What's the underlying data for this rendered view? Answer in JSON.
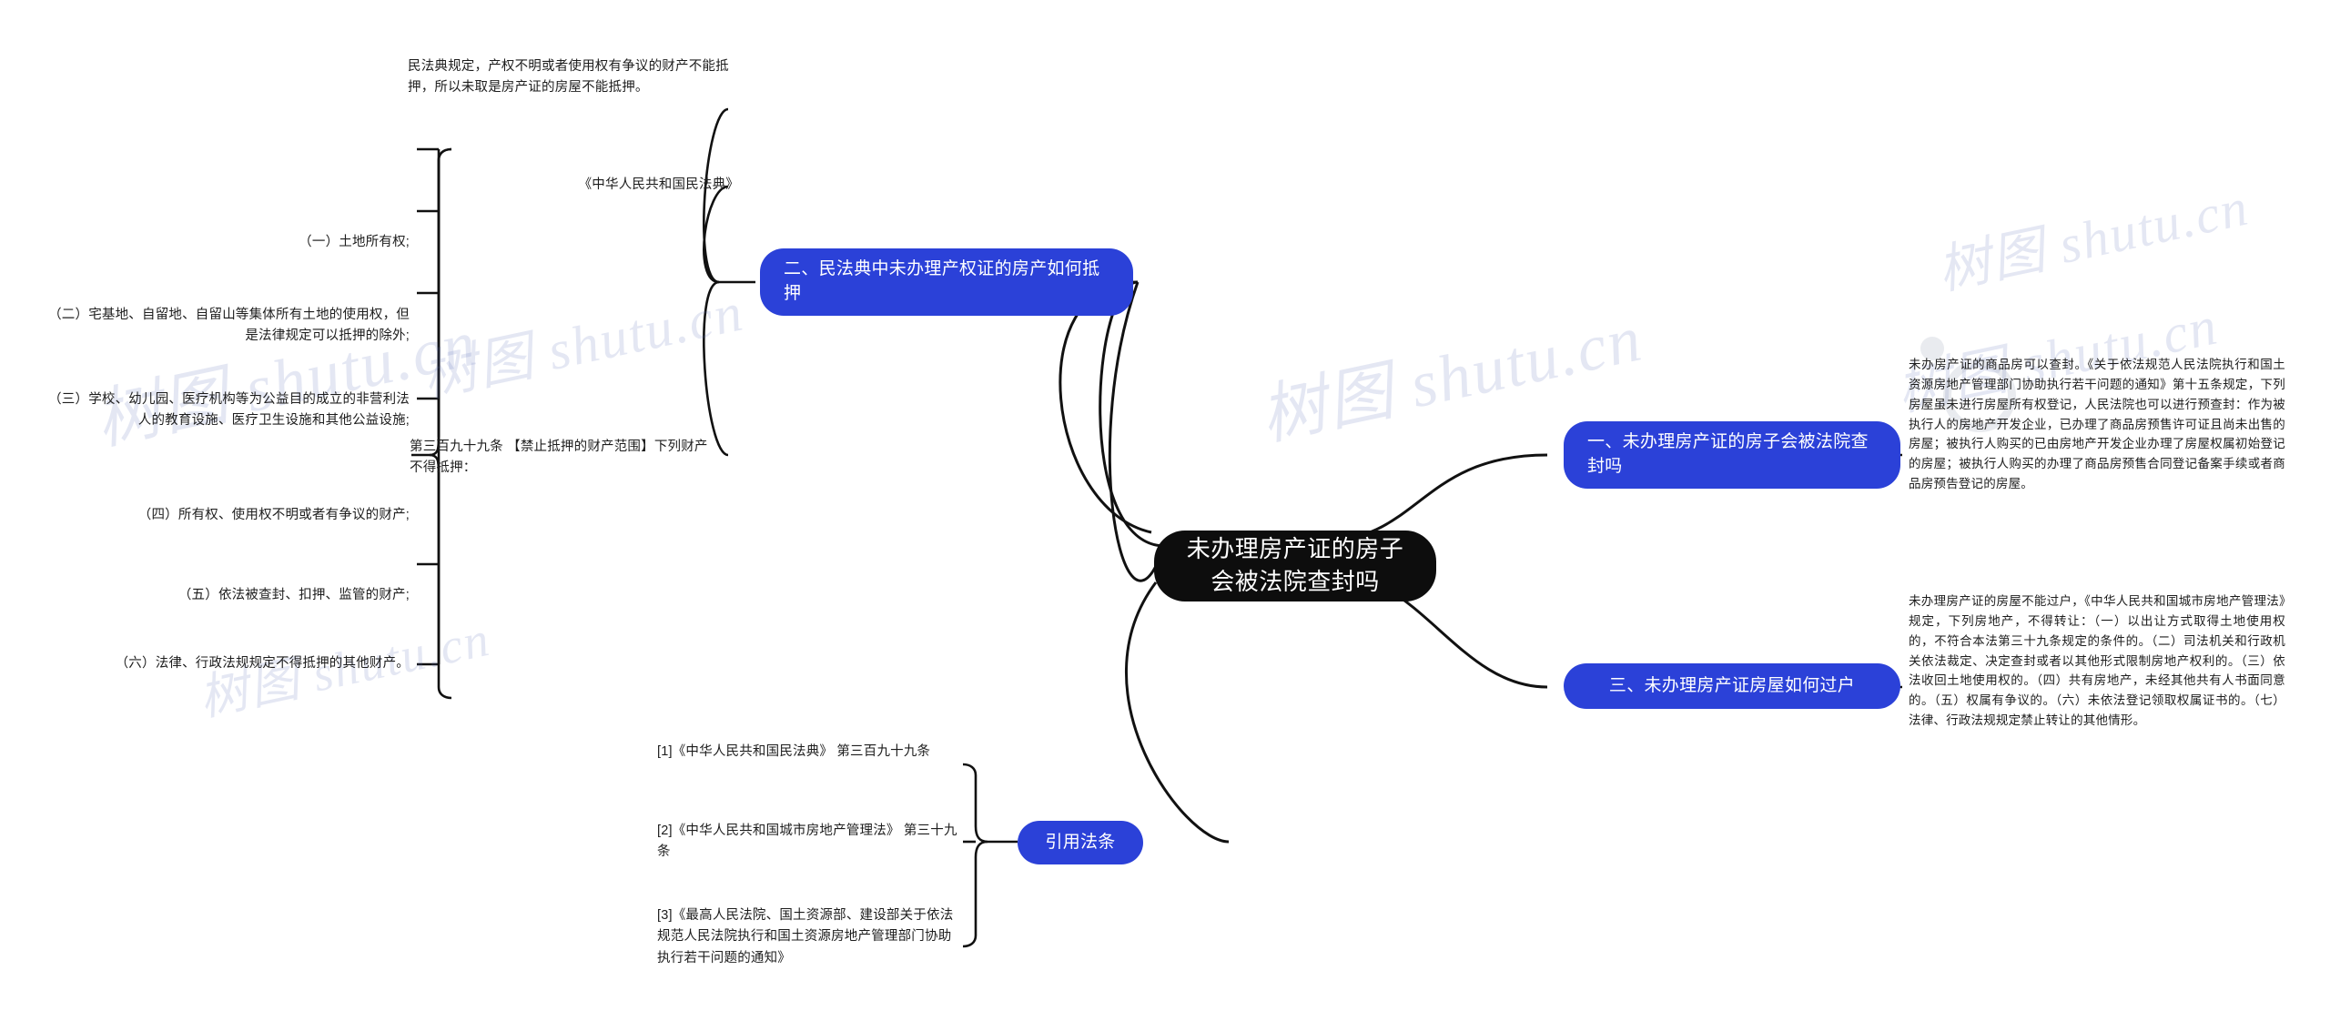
{
  "meta": {
    "root_bg": "#0d0d0d",
    "branch_bg": "#2b41d8",
    "text_color": "#1d1d1d",
    "watermark_text": "树图 shutu.cn"
  },
  "root": {
    "label": "未办理房产证的房子会被法院查封吗"
  },
  "branches": [
    {
      "id": "branch-2",
      "label": "二、民法典中未办理产权证的房产如何抵押"
    },
    {
      "id": "branch-1",
      "label": "一、未办理房产证的房子会被法院查封吗"
    },
    {
      "id": "branch-3",
      "label": "三、未办理房产证房屋如何过户"
    },
    {
      "id": "branch-citations",
      "label": "引用法条"
    }
  ],
  "branch2_children": {
    "summary": "民法典规定，产权不明或者使用权有争议的财产不能抵押，所以未取是房产证的房屋不能抵押。",
    "law_title": "《中华人民共和国民法典》",
    "article_title": "第三百九十九条 【禁止抵押的财产范围】下列财产不得抵押：",
    "article_items": [
      "（一）土地所有权;",
      "（二）宅基地、自留地、自留山等集体所有土地的使用权，但是法律规定可以抵押的除外;",
      "（三）学校、幼儿园、医疗机构等为公益目的成立的非营利法人的教育设施、医疗卫生设施和其他公益设施;",
      "（四）所有权、使用权不明或者有争议的财产;",
      "（五）依法被查封、扣押、监管的财产;",
      "（六）法律、行政法规规定不得抵押的其他财产。"
    ]
  },
  "branch1_children": {
    "detail": "未办房产证的商品房可以查封。《关于依法规范人民法院执行和国土资源房地产管理部门协助执行若干问题的通知》第十五条规定，下列房屋虽未进行房屋所有权登记，人民法院也可以进行预查封：作为被执行人的房地产开发企业，已办理了商品房预售许可证且尚未出售的房屋；被执行人购买的已由房地产开发企业办理了房屋权属初始登记的房屋；被执行人购买的办理了商品房预售合同登记备案手续或者商品房预告登记的房屋。"
  },
  "branch3_children": {
    "detail": "未办理房产证的房屋不能过户，《中华人民共和国城市房地产管理法》规定，下列房地产，不得转让：（一）以出让方式取得土地使用权的，不符合本法第三十九条规定的条件的。（二）司法机关和行政机关依法裁定、决定查封或者以其他形式限制房地产权利的。（三）依法收回土地使用权的。（四）共有房地产，未经其他共有人书面同意的。（五）权属有争议的。（六）未依法登记领取权属证书的。（七）法律、行政法规规定禁止转让的其他情形。"
  },
  "citations": [
    "[1]《中华人民共和国民法典》 第三百九十九条",
    "[2]《中华人民共和国城市房地产管理法》 第三十九条",
    "[3]《最高人民法院、国土资源部、建设部关于依法规范人民法院执行和国土资源房地产管理部门协助执行若干问题的通知》"
  ]
}
